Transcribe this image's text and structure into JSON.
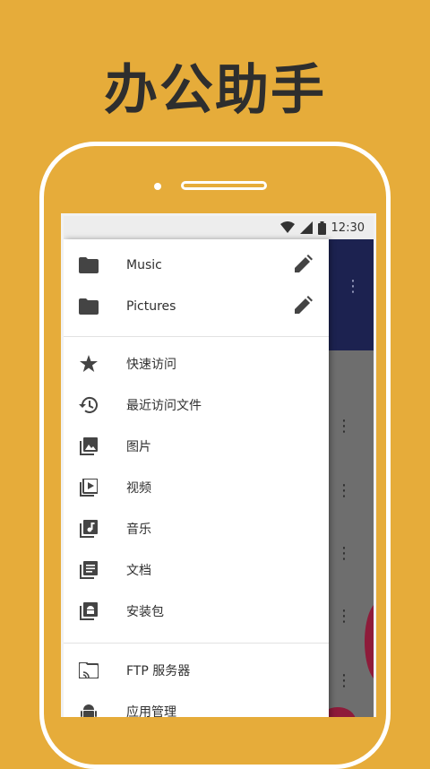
{
  "headline": "办公助手",
  "status_bar": {
    "time": "12:30"
  },
  "drawer": {
    "bookmarks": [
      {
        "label": "Music",
        "icon": "folder-icon"
      },
      {
        "label": "Pictures",
        "icon": "folder-icon"
      }
    ],
    "categories": [
      {
        "label": "快速访问",
        "icon": "star-icon"
      },
      {
        "label": "最近访问文件",
        "icon": "history-icon"
      },
      {
        "label": "图片",
        "icon": "image-library-icon"
      },
      {
        "label": "视频",
        "icon": "video-library-icon"
      },
      {
        "label": "音乐",
        "icon": "music-library-icon"
      },
      {
        "label": "文档",
        "icon": "document-library-icon"
      },
      {
        "label": "安装包",
        "icon": "apk-library-icon"
      }
    ],
    "tools": [
      {
        "label": "FTP 服务器",
        "icon": "ftp-server-icon"
      },
      {
        "label": "应用管理",
        "icon": "android-icon"
      }
    ]
  },
  "colors": {
    "background": "#E6AC3A",
    "app_bar": "#1C2250",
    "icon": "#444444"
  }
}
